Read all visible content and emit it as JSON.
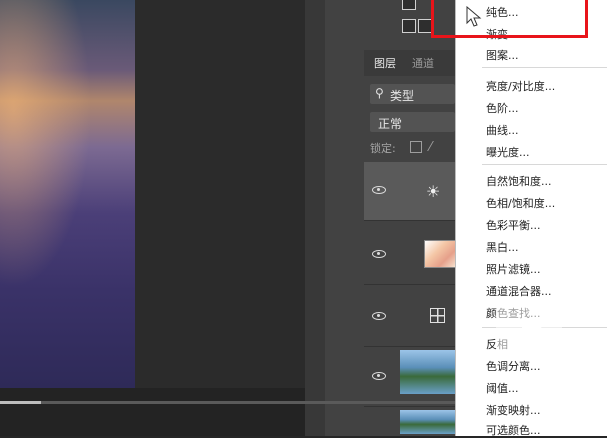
{
  "layers_panel": {
    "tabs": [
      {
        "label": "图层",
        "active": true
      },
      {
        "label": "通道",
        "active": false
      }
    ],
    "filter": {
      "glyph": "⚲",
      "label": "类型"
    },
    "blend_mode": "正常",
    "lock_label": "锁定:",
    "layers": [
      {
        "thumb": "sun-adjustment-icon"
      },
      {
        "thumb": "gradient-fill-icon"
      },
      {
        "thumb": "grid-pattern-icon"
      },
      {
        "thumb": "photo-thumbnail"
      }
    ]
  },
  "adjustment_menu": {
    "groups": [
      [
        "纯色...",
        "渐变...",
        "图案..."
      ],
      [
        "亮度/对比度...",
        "色阶...",
        "曲线...",
        "曝光度..."
      ],
      [
        "自然饱和度...",
        "色相/饱和度...",
        "色彩平衡...",
        "黑白...",
        "照片滤镜...",
        "通道混合器...",
        "颜色查找..."
      ],
      [
        "反相",
        "色调分离...",
        "阈值...",
        "渐变映射...",
        "可选颜色..."
      ]
    ]
  },
  "icons": {
    "sun": "☀",
    "play_overlay": "play-icon"
  },
  "colors": {
    "highlight": "#e8141a",
    "menu_bg": "#ffffff",
    "panel_bg": "#424242"
  },
  "timeline": {
    "progress": 0.09
  }
}
